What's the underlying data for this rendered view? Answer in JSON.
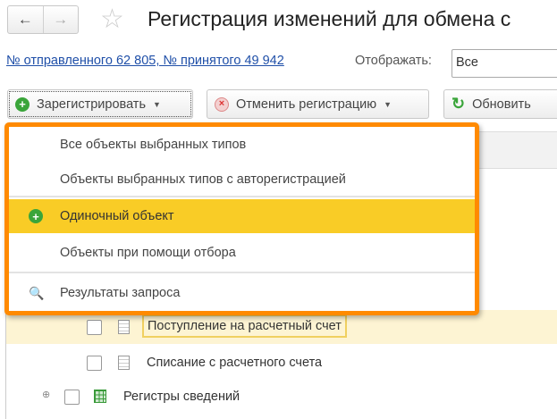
{
  "header": {
    "title": "Регистрация изменений для обмена с",
    "back_icon": "←",
    "forward_icon": "→",
    "favorite_icon": "☆"
  },
  "info": {
    "link": "№ отправленного 62 805, № принятого 49 942",
    "display_label": "Отображать:",
    "display_value": "Все"
  },
  "toolbar": {
    "register": "Зарегистрировать",
    "cancel": "Отменить регистрацию",
    "refresh": "Обновить"
  },
  "menu": {
    "items": [
      "Все объекты выбранных типов",
      "Объекты выбранных типов с авторегистрацией",
      "Одиночный объект",
      "Объекты при помощи отбора",
      "Результаты запроса"
    ]
  },
  "tree": {
    "rows": [
      "Поступление на расчетный счет",
      "Списание с расчетного счета",
      "Регистры сведений"
    ]
  },
  "colors": {
    "accent": "#ff8a00",
    "highlight": "#f9cc26"
  }
}
